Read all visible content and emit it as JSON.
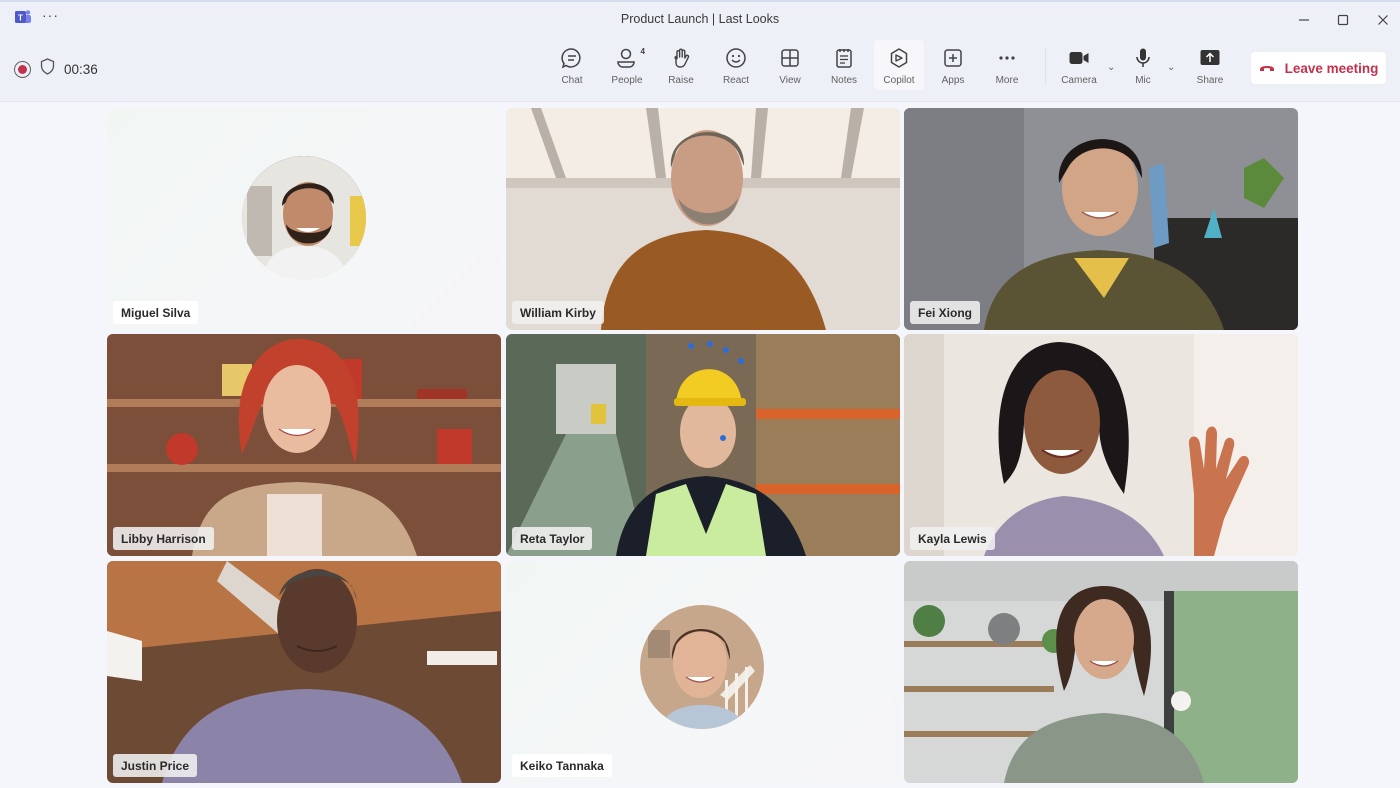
{
  "window": {
    "title": "Product Launch | Last Looks",
    "app_icon": "teams-icon",
    "more_icon": "more-horizontal-icon",
    "controls": {
      "minimize": "minimize-icon",
      "maximize": "maximize-icon",
      "close": "close-icon"
    }
  },
  "status": {
    "recording_icon": "record-icon",
    "security_icon": "shield-icon",
    "elapsed_time": "00:36"
  },
  "toolbar": {
    "buttons": [
      {
        "id": "chat",
        "label": "Chat",
        "icon": "chat-icon"
      },
      {
        "id": "people",
        "label": "People",
        "icon": "people-icon",
        "badge": "4"
      },
      {
        "id": "raise",
        "label": "Raise",
        "icon": "hand-icon"
      },
      {
        "id": "react",
        "label": "React",
        "icon": "smiley-icon"
      },
      {
        "id": "view",
        "label": "View",
        "icon": "grid-icon"
      },
      {
        "id": "notes",
        "label": "Notes",
        "icon": "notes-icon"
      },
      {
        "id": "copilot",
        "label": "Copilot",
        "icon": "copilot-icon"
      },
      {
        "id": "apps",
        "label": "Apps",
        "icon": "add-app-icon"
      },
      {
        "id": "more",
        "label": "More",
        "icon": "more-icon"
      },
      {
        "id": "camera",
        "label": "Camera",
        "icon": "camera-icon"
      },
      {
        "id": "mic",
        "label": "Mic",
        "icon": "mic-icon"
      },
      {
        "id": "share",
        "label": "Share",
        "icon": "share-icon"
      }
    ],
    "leave": {
      "label": "Leave meeting",
      "icon": "hang-up-icon",
      "color": "#c4314b"
    }
  },
  "participants": [
    {
      "name": "Miguel Silva",
      "video": false
    },
    {
      "name": "William Kirby",
      "video": true
    },
    {
      "name": "Fei Xiong",
      "video": true
    },
    {
      "name": "Libby Harrison",
      "video": true
    },
    {
      "name": "Reta Taylor",
      "video": true
    },
    {
      "name": "Kayla Lewis",
      "video": true,
      "avatar": true
    },
    {
      "name": "Justin Price",
      "video": true
    },
    {
      "name": "Keiko Tannaka",
      "video": false
    },
    {
      "name": "",
      "video": true
    }
  ],
  "colors": {
    "accent_teams": "#5b5fc7",
    "leave_red": "#c4314b",
    "background": "#f5f6fb"
  }
}
